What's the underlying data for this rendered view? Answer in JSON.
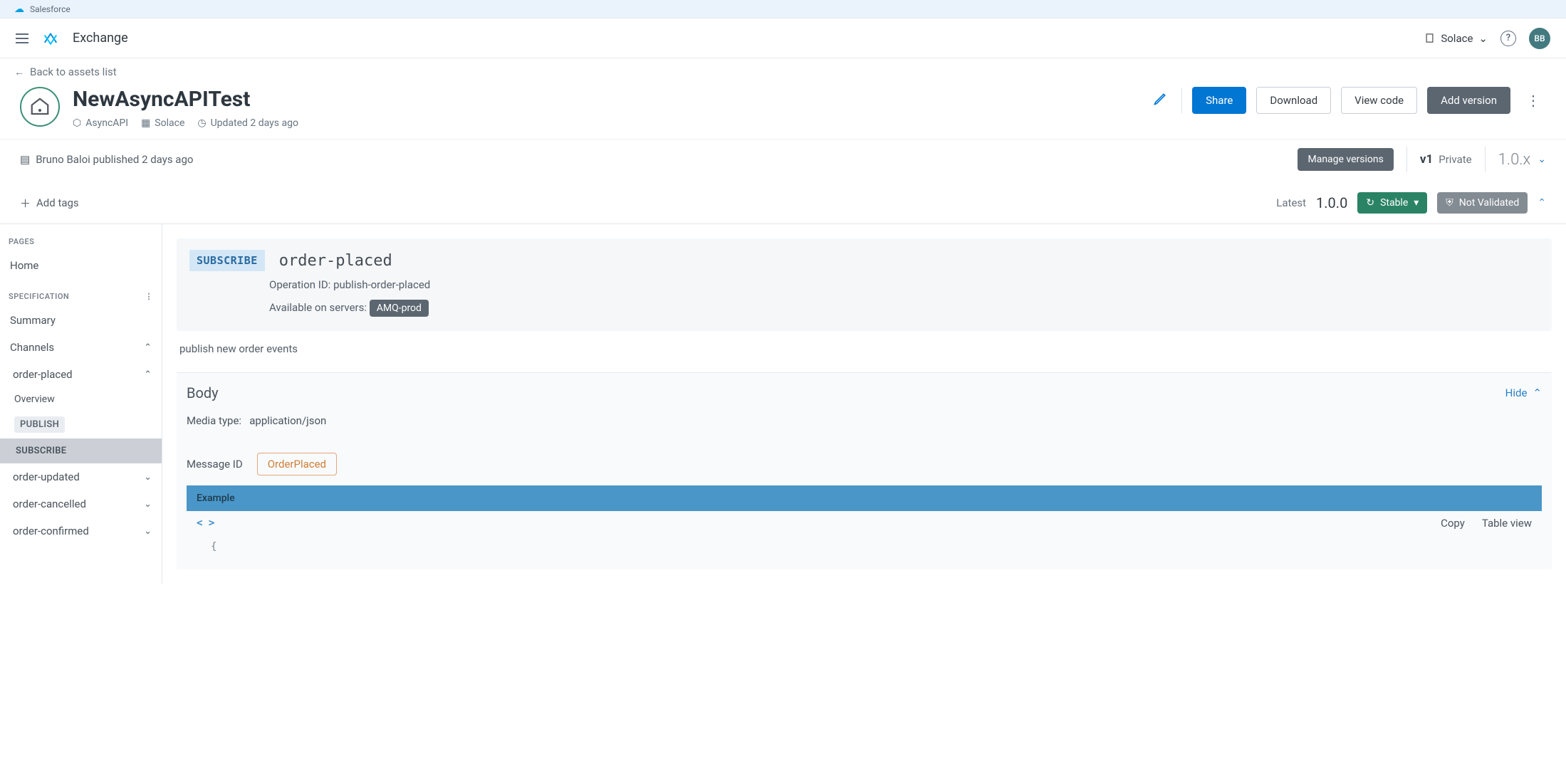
{
  "sf_bar": {
    "label": "Salesforce"
  },
  "header": {
    "product": "Exchange",
    "org": "Solace",
    "avatar_initials": "BB"
  },
  "back": {
    "label": "Back to assets list"
  },
  "asset": {
    "title": "NewAsyncAPITest",
    "type": "AsyncAPI",
    "org": "Solace",
    "updated": "Updated 2 days ago",
    "edit_label": "Edit",
    "actions": {
      "share": "Share",
      "download": "Download",
      "view_code": "View code",
      "add_version": "Add version"
    }
  },
  "publish_info": "Bruno Baloi published 2 days ago",
  "version_bar": {
    "manage": "Manage versions",
    "major": "v1",
    "visibility": "Private",
    "range": "1.0.x"
  },
  "status_row": {
    "add_tags": "Add tags",
    "latest_label": "Latest",
    "latest_version": "1.0.0",
    "stable": "Stable",
    "not_validated": "Not Validated"
  },
  "sidebar": {
    "pages_label": "PAGES",
    "home": "Home",
    "spec_label": "SPECIFICATION",
    "summary": "Summary",
    "channels": "Channels",
    "channel_items": {
      "order_placed": "order-placed",
      "overview": "Overview",
      "publish": "PUBLISH",
      "subscribe": "SUBSCRIBE",
      "order_updated": "order-updated",
      "order_cancelled": "order-cancelled",
      "order_confirmed": "order-confirmed"
    }
  },
  "operation": {
    "verb": "SUBSCRIBE",
    "name": "order-placed",
    "op_id_label": "Operation ID:",
    "op_id": "publish-order-placed",
    "servers_label": "Available on servers:",
    "server": "AMQ-prod",
    "description": "publish new order events"
  },
  "body": {
    "title": "Body",
    "hide": "Hide",
    "media_label": "Media type:",
    "media_value": "application/json",
    "message_label": "Message ID",
    "message_value": "OrderPlaced",
    "example_label": "Example",
    "copy": "Copy",
    "table_view": "Table view"
  }
}
